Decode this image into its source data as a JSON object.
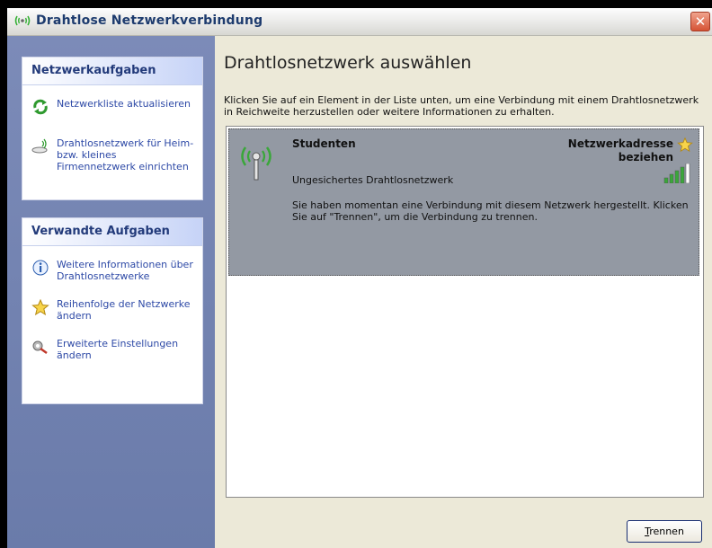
{
  "window": {
    "title": "Drahtlose Netzwerkverbindung"
  },
  "sidebar": {
    "network_tasks": {
      "heading": "Netzwerkaufgaben",
      "items": [
        {
          "label": "Netzwerkliste aktualisieren",
          "icon": "refresh-icon"
        },
        {
          "label": "Drahtlosnetzwerk für Heim- bzw. kleines Firmennetzwerk einrichten",
          "icon": "wireless-setup-icon"
        }
      ]
    },
    "related_tasks": {
      "heading": "Verwandte Aufgaben",
      "items": [
        {
          "label": "Weitere Informationen über Drahtlosnetzwerke",
          "icon": "info-icon"
        },
        {
          "label": "Reihenfolge der Netzwerke ändern",
          "icon": "star-icon"
        },
        {
          "label": "Erweiterte Einstellungen ändern",
          "icon": "settings-icon"
        }
      ]
    }
  },
  "main": {
    "heading": "Drahtlosnetzwerk auswählen",
    "instruction": "Klicken Sie auf ein Element in der Liste unten, um eine Verbindung mit einem Drahtlosnetzwerk in Reichweite herzustellen oder weitere Informationen zu erhalten.",
    "networks": [
      {
        "name": "Studenten",
        "status_line1": "Netzwerkadresse",
        "status_line2": "beziehen",
        "security": "Ungesichertes Drahtlosnetzwerk",
        "message": "Sie haben momentan eine Verbindung mit diesem Netzwerk hergestellt. Klicken Sie auf \"Trennen\", um die Verbindung zu trennen.",
        "signal_bars": 4,
        "signal_max": 5
      }
    ],
    "button_label": "Trennen"
  },
  "colors": {
    "accent": "#2d49a6",
    "sidebar_bg": "#7c8bb8",
    "selected_item": "#9399a3",
    "signal": "#3aa73a"
  }
}
